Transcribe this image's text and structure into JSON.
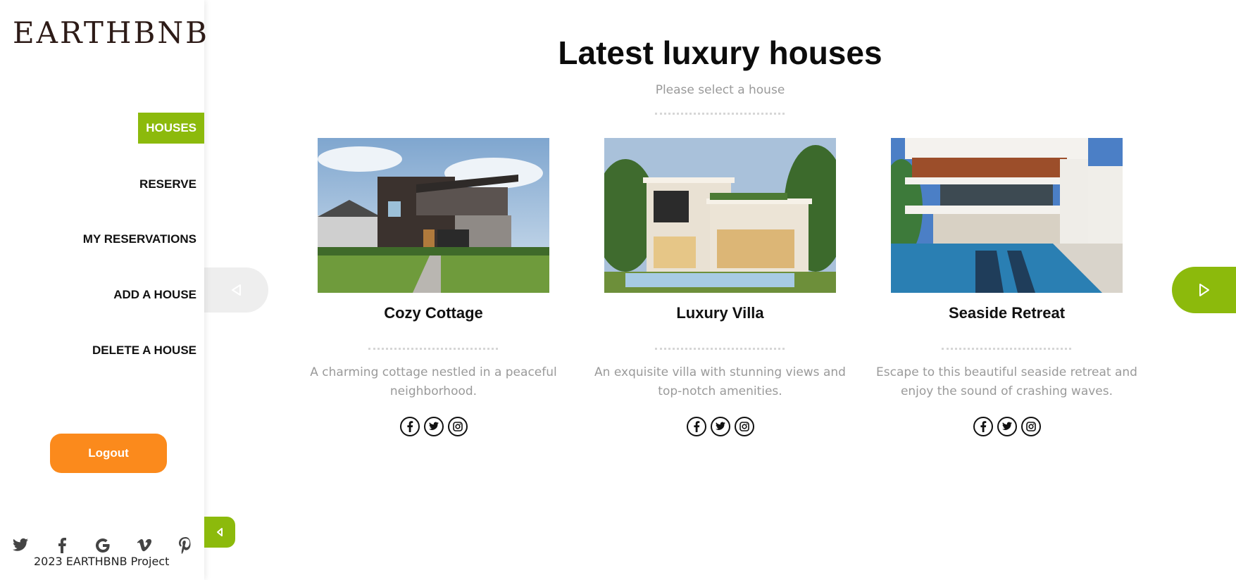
{
  "brand": {
    "logo": "EARTHBNB"
  },
  "nav": {
    "items": [
      {
        "label": "HOUSES",
        "active": true
      },
      {
        "label": "RESERVE",
        "active": false
      },
      {
        "label": "MY RESERVATIONS",
        "active": false
      },
      {
        "label": "ADD A HOUSE",
        "active": false
      },
      {
        "label": "DELETE A HOUSE",
        "active": false
      }
    ],
    "logout_label": "Logout"
  },
  "footer": {
    "social_icons": [
      "twitter-icon",
      "facebook-icon",
      "google-icon",
      "vimeo-icon",
      "pinterest-icon"
    ],
    "copyright": "2023 EARTHBNB Project"
  },
  "main": {
    "title": "Latest luxury houses",
    "subtitle": "Please select a house",
    "houses": [
      {
        "name": "Cozy Cottage",
        "description": "A charming cottage nestled in a peaceful neighborhood.",
        "social_icons": [
          "facebook-icon",
          "twitter-icon",
          "instagram-icon"
        ]
      },
      {
        "name": "Luxury Villa",
        "description": "An exquisite villa with stunning views and top-notch amenities.",
        "social_icons": [
          "facebook-icon",
          "twitter-icon",
          "instagram-icon"
        ]
      },
      {
        "name": "Seaside Retreat",
        "description": "Escape to this beautiful seaside retreat and enjoy the sound of crashing waves.",
        "social_icons": [
          "facebook-icon",
          "twitter-icon",
          "instagram-icon"
        ]
      }
    ]
  },
  "colors": {
    "accent_green": "#8cba0c",
    "logout_orange": "#fb8a1c",
    "text_muted": "#9a9a9a"
  }
}
